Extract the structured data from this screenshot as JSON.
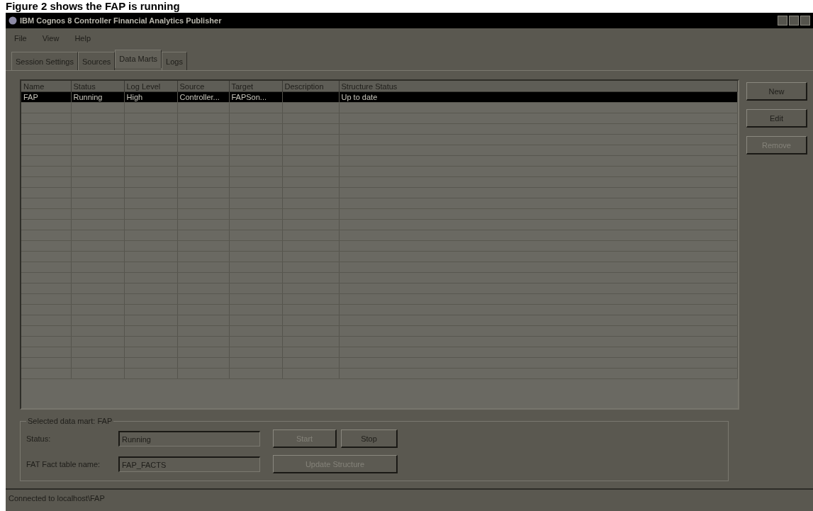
{
  "caption": "Figure 2 shows the FAP is running",
  "window": {
    "title": "IBM Cognos 8 Controller Financial Analytics Publisher"
  },
  "menu": [
    "File",
    "View",
    "Help"
  ],
  "tabs": [
    {
      "label": "Session Settings",
      "selected": false
    },
    {
      "label": "Sources",
      "selected": false
    },
    {
      "label": "Data Marts",
      "selected": true
    },
    {
      "label": "Logs",
      "selected": false
    }
  ],
  "table": {
    "columns": [
      "Name",
      "Status",
      "Log Level",
      "Source",
      "Target",
      "Description",
      "Structure Status"
    ],
    "rows": [
      {
        "cells": [
          "FAP",
          "Running",
          "High",
          "Controller...",
          "FAPSon...",
          "",
          "Up to date"
        ],
        "selected": true
      }
    ]
  },
  "side_buttons": [
    {
      "label": "New",
      "disabled": false
    },
    {
      "label": "Edit",
      "disabled": false
    },
    {
      "label": "Remove",
      "disabled": true
    }
  ],
  "group": {
    "title": "Selected data mart: FAP",
    "status_label": "Status:",
    "status_value": "Running",
    "fact_label": "FAT Fact table name:",
    "fact_value": "FAP_FACTS",
    "buttons": [
      {
        "label": "Start",
        "disabled": true
      },
      {
        "label": "Stop",
        "disabled": false
      },
      {
        "label": "Update Structure",
        "disabled": true
      }
    ]
  },
  "status_bar": "Connected to localhost\\FAP"
}
